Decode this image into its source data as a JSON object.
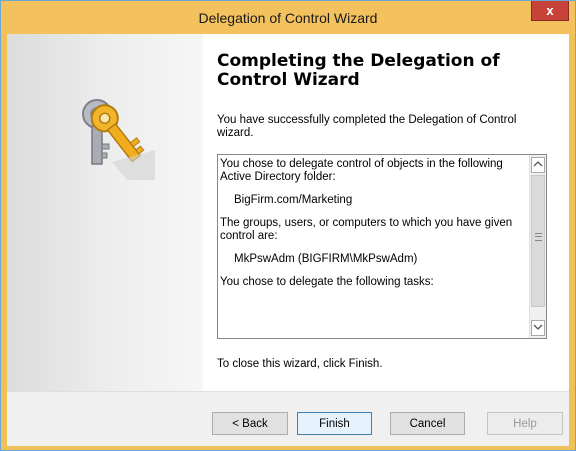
{
  "window": {
    "title": "Delegation of Control Wizard",
    "close_glyph": "x"
  },
  "wizard": {
    "heading": "Completing the Delegation of Control Wizard",
    "intro": "You have successfully completed the Delegation of Control wizard.",
    "summary": {
      "line1": "You chose to delegate control of objects in the following Active Directory folder:",
      "folder": "BigFirm.com/Marketing",
      "line2": "The groups, users, or computers to which you have given control are:",
      "principal": "MkPswAdm (BIGFIRM\\MkPswAdm)",
      "line3": "You chose to delegate the following tasks:"
    },
    "finish_hint": "To close this wizard, click Finish."
  },
  "buttons": {
    "back": "< Back",
    "finish": "Finish",
    "cancel": "Cancel",
    "help": "Help"
  },
  "icons": {
    "wizard_graphic": "keys-icon",
    "scroll_up": "chevron-up-icon",
    "scroll_down": "chevron-down-icon"
  }
}
